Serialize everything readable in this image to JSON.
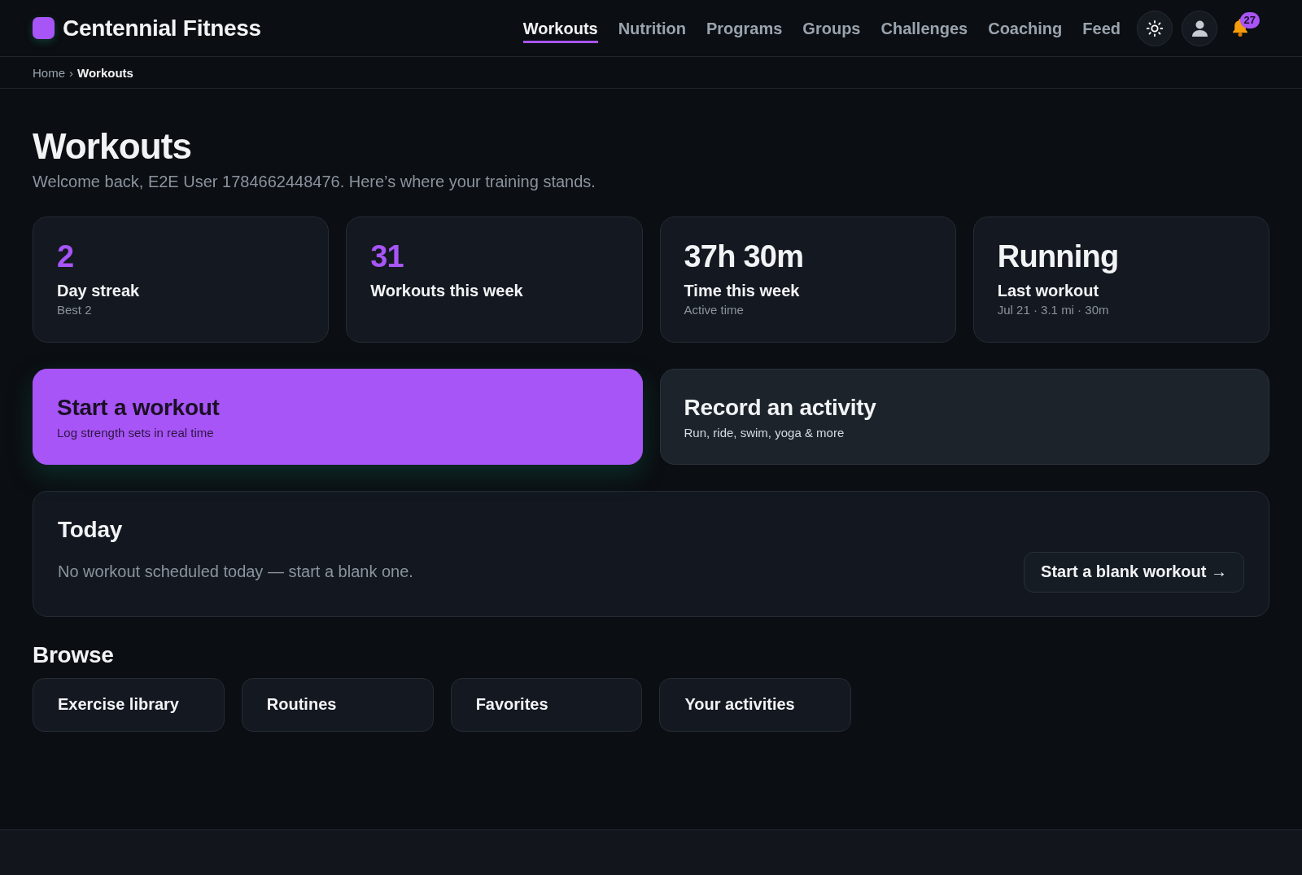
{
  "brand": {
    "name": "Centennial Fitness"
  },
  "nav": [
    {
      "label": "Workouts",
      "selected": true
    },
    {
      "label": "Nutrition",
      "selected": false
    },
    {
      "label": "Programs",
      "selected": false
    },
    {
      "label": "Groups",
      "selected": false
    },
    {
      "label": "Challenges",
      "selected": false
    },
    {
      "label": "Coaching",
      "selected": false
    },
    {
      "label": "Feed",
      "selected": false
    }
  ],
  "notifications": {
    "count": "27"
  },
  "breadcrumb": {
    "separator": "›",
    "items": [
      "Home",
      "Workouts"
    ]
  },
  "page": {
    "title": "Workouts",
    "subtitle": "Welcome back, E2E User 1784662448476. Here’s where your training stands."
  },
  "stats": [
    {
      "value": "2",
      "label": "Day streak",
      "note": "Best 2",
      "accent": true
    },
    {
      "value": "31",
      "label": "Workouts this week",
      "accent": true
    },
    {
      "value": "37h 30m",
      "label": "Time this week",
      "note": "Active time",
      "accent": false
    },
    {
      "value": "Running",
      "label": "Last workout",
      "note": "Jul 21 · 3.1 mi · 30m",
      "accent": false
    }
  ],
  "actions": [
    {
      "kind": "primary",
      "title": "Start a workout",
      "subtitle": "Log strength sets in real time"
    },
    {
      "kind": "secondary",
      "title": "Record an activity",
      "subtitle": "Run, ride, swim, yoga & more"
    }
  ],
  "today": {
    "title": "Today",
    "message": "No workout scheduled today — start a blank one.",
    "button": "Start a blank workout →"
  },
  "browse": {
    "title": "Browse",
    "items": [
      "Exercise library",
      "Routines",
      "Favorites",
      "Your activities"
    ]
  }
}
